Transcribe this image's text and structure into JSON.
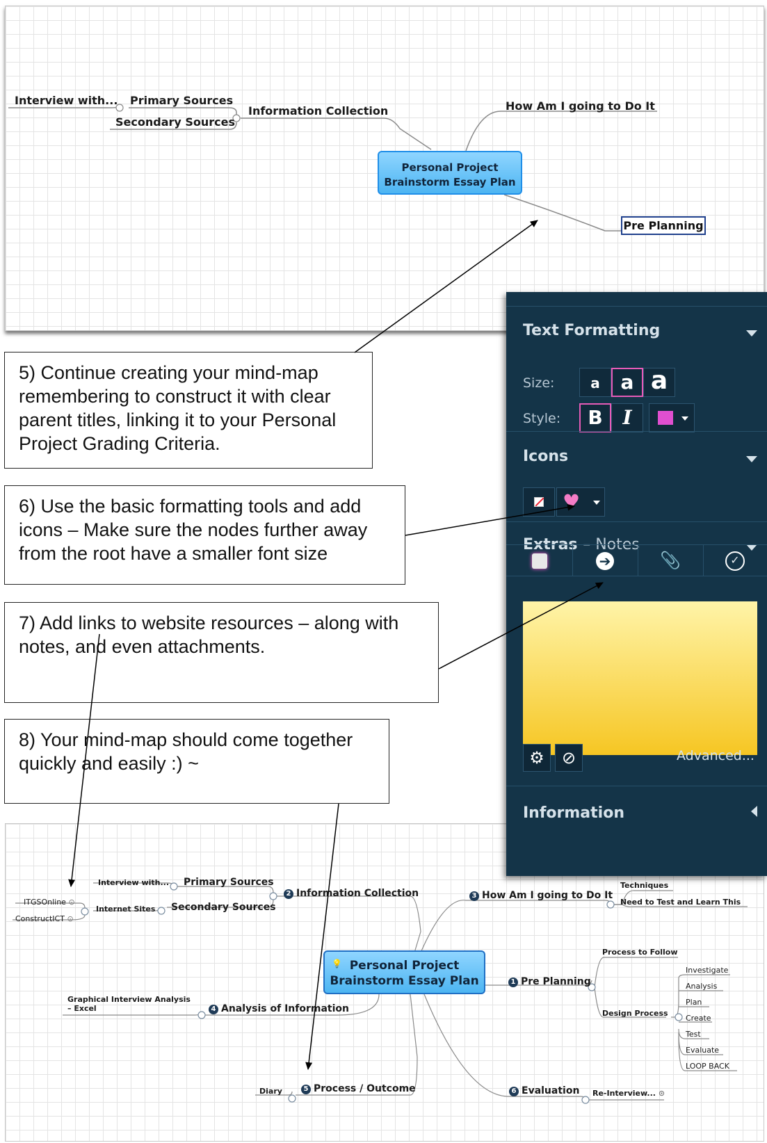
{
  "map_top": {
    "root": [
      "Personal Project",
      "Brainstorm Essay Plan"
    ],
    "nodes": {
      "interview": "Interview with...",
      "primary": "Primary Sources",
      "secondary": "Secondary Sources",
      "info_collection": "Information Collection",
      "how": "How Am I going to Do It",
      "pre_planning": "Pre Planning"
    }
  },
  "callouts": {
    "c5": "5) Continue creating your mind-map remembering to construct it with clear parent titles, linking it to your Personal Project Grading Criteria.",
    "c6": "6) Use the basic formatting tools and add icons – Make sure the nodes further away from the root have a  smaller font size",
    "c7": "7) Add links to website resources – along with notes, and even attachments.",
    "c8": "8) Your mind-map should come together quickly and easily :) ~"
  },
  "panel": {
    "text_formatting": "Text Formatting",
    "size_label": "Size:",
    "style_label": "Style:",
    "size_buttons": [
      "a",
      "a",
      "a"
    ],
    "bold": "B",
    "italic": "I",
    "text_color": "#e04fd0",
    "icons_header": "Icons",
    "extras_header": "Extras",
    "extras_sub": "– Notes",
    "advanced": "Advanced...",
    "information_header": "Information"
  },
  "map_bottom": {
    "root": [
      "Personal Project",
      "Brainstorm Essay Plan"
    ],
    "nodes": {
      "itgs": "ITGSOnline",
      "constructict": "ConstructICT",
      "interview": "Interview with...",
      "internet": "Internet Sites",
      "primary": "Primary Sources",
      "secondary": "Secondary Sources",
      "info_collection": "Information Collection",
      "how": "How Am I going to Do It",
      "techniques": "Techniques",
      "need": "Need to Test and Learn This",
      "pre_planning": "Pre Planning",
      "process_follow": "Process to Follow",
      "design_process": "Design Process",
      "investigate": "Investigate",
      "analysis": "Analysis",
      "plan": "Plan",
      "create": "Create",
      "test": "Test",
      "evaluate": "Evaluate",
      "loop": "LOOP BACK",
      "graphical": "Graphical Interview Analysis",
      "excel": "– Excel",
      "analysis_info": "Analysis of Information",
      "diary": "Diary",
      "process_outcome": "Process / Outcome",
      "evaluation": "Evaluation",
      "reinterview": "Re-Interview..."
    },
    "numbers": {
      "pre": "1",
      "info": "2",
      "how": "3",
      "analysis": "4",
      "process": "5",
      "eval": "6"
    }
  }
}
